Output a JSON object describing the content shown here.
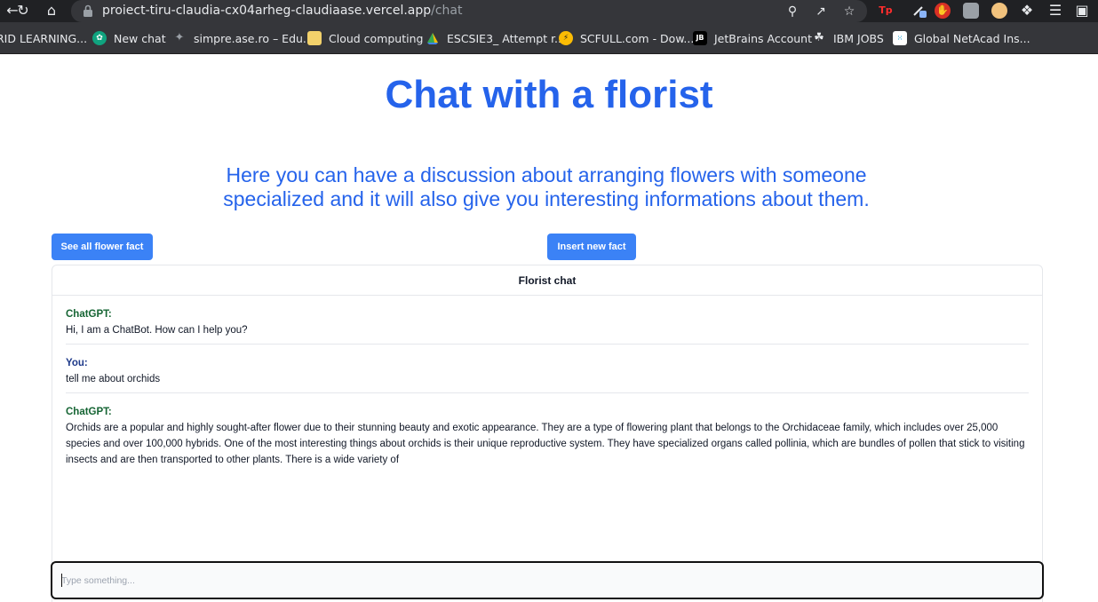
{
  "browser": {
    "url_host": "proiect-tiru-claudia-cx04arheg-claudiaase.vercel.app",
    "url_path": "/chat",
    "bookmarks": [
      {
        "label": "RID LEARNING...",
        "icon": "folder-icon"
      },
      {
        "label": "New chat",
        "icon": "chatgpt-icon"
      },
      {
        "label": "simpre.ase.ro – Edu...",
        "icon": "simpre-icon"
      },
      {
        "label": "Cloud computing",
        "icon": "folder-icon"
      },
      {
        "label": "ESCSIE3_ Attempt r...",
        "icon": "drive-icon"
      },
      {
        "label": "SCFULL.com - Dow...",
        "icon": "scfull-icon"
      },
      {
        "label": "JetBrains Account",
        "icon": "jetbrains-icon"
      },
      {
        "label": "IBM JOBS",
        "icon": "ibm-icon"
      },
      {
        "label": "Global NetAcad Ins...",
        "icon": "cisco-icon"
      }
    ]
  },
  "page": {
    "title": "Chat with a florist",
    "subtitle": "Here you can have a discussion about arranging flowers with someone specialized and it will also give you interesting informations about them.",
    "see_facts_button": "See all flower fact",
    "insert_fact_button": "Insert new fact"
  },
  "chat": {
    "header": "Florist chat",
    "messages": [
      {
        "sender": "ChatGPT:",
        "role": "bot",
        "text": "Hi, I am a ChatBot. How can I help you?"
      },
      {
        "sender": "You:",
        "role": "user",
        "text": "tell me about orchids"
      },
      {
        "sender": "ChatGPT:",
        "role": "bot",
        "text": "Orchids are a popular and highly sought-after flower due to their stunning beauty and exotic appearance. They are a type of flowering plant that belongs to the Orchidaceae family, which includes over 25,000 species and over 100,000 hybrids. One of the most interesting things about orchids is their unique reproductive system. They have specialized organs called pollinia, which are bundles of pollen that stick to visiting insects and are then transported to other plants. There is a wide variety of"
      }
    ],
    "input_placeholder": "Type something...",
    "input_value": ""
  },
  "colors": {
    "accent": "#2563eb",
    "button": "#3b82f6",
    "bot_sender": "#166534",
    "user_sender": "#1e3a8a"
  }
}
